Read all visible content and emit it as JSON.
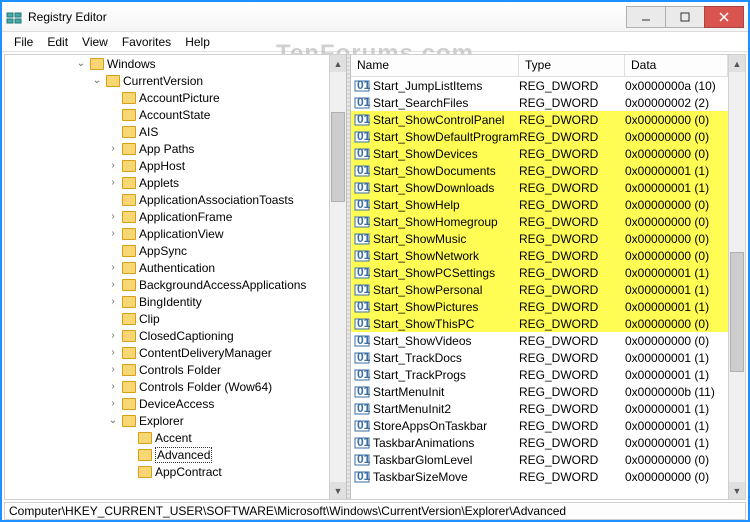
{
  "window": {
    "title": "Registry Editor"
  },
  "menu": [
    "File",
    "Edit",
    "View",
    "Favorites",
    "Help"
  ],
  "watermark": "TenForums.com",
  "tree": [
    {
      "d": 5,
      "e": "v",
      "l": "Windows"
    },
    {
      "d": 6,
      "e": "v",
      "l": "CurrentVersion"
    },
    {
      "d": 7,
      "e": "",
      "l": "AccountPicture"
    },
    {
      "d": 7,
      "e": "",
      "l": "AccountState"
    },
    {
      "d": 7,
      "e": "",
      "l": "AIS"
    },
    {
      "d": 7,
      "e": ">",
      "l": "App Paths"
    },
    {
      "d": 7,
      "e": ">",
      "l": "AppHost"
    },
    {
      "d": 7,
      "e": ">",
      "l": "Applets"
    },
    {
      "d": 7,
      "e": "",
      "l": "ApplicationAssociationToasts"
    },
    {
      "d": 7,
      "e": ">",
      "l": "ApplicationFrame"
    },
    {
      "d": 7,
      "e": ">",
      "l": "ApplicationView"
    },
    {
      "d": 7,
      "e": "",
      "l": "AppSync"
    },
    {
      "d": 7,
      "e": ">",
      "l": "Authentication"
    },
    {
      "d": 7,
      "e": ">",
      "l": "BackgroundAccessApplications"
    },
    {
      "d": 7,
      "e": ">",
      "l": "BingIdentity"
    },
    {
      "d": 7,
      "e": "",
      "l": "Clip"
    },
    {
      "d": 7,
      "e": ">",
      "l": "ClosedCaptioning"
    },
    {
      "d": 7,
      "e": ">",
      "l": "ContentDeliveryManager"
    },
    {
      "d": 7,
      "e": ">",
      "l": "Controls Folder"
    },
    {
      "d": 7,
      "e": ">",
      "l": "Controls Folder (Wow64)"
    },
    {
      "d": 7,
      "e": ">",
      "l": "DeviceAccess"
    },
    {
      "d": 7,
      "e": "v",
      "l": "Explorer"
    },
    {
      "d": 8,
      "e": "",
      "l": "Accent"
    },
    {
      "d": 8,
      "e": "",
      "l": "Advanced",
      "sel": true
    },
    {
      "d": 8,
      "e": "",
      "l": "AppContract"
    }
  ],
  "columns": {
    "name": "Name",
    "type": "Type",
    "data": "Data"
  },
  "values": [
    {
      "n": "Start_JumpListItems",
      "t": "REG_DWORD",
      "d": "0x0000000a (10)",
      "hl": false
    },
    {
      "n": "Start_SearchFiles",
      "t": "REG_DWORD",
      "d": "0x00000002 (2)",
      "hl": false
    },
    {
      "n": "Start_ShowControlPanel",
      "t": "REG_DWORD",
      "d": "0x00000000 (0)",
      "hl": true
    },
    {
      "n": "Start_ShowDefaultPrograms",
      "t": "REG_DWORD",
      "d": "0x00000000 (0)",
      "hl": true
    },
    {
      "n": "Start_ShowDevices",
      "t": "REG_DWORD",
      "d": "0x00000000 (0)",
      "hl": true
    },
    {
      "n": "Start_ShowDocuments",
      "t": "REG_DWORD",
      "d": "0x00000001 (1)",
      "hl": true
    },
    {
      "n": "Start_ShowDownloads",
      "t": "REG_DWORD",
      "d": "0x00000001 (1)",
      "hl": true
    },
    {
      "n": "Start_ShowHelp",
      "t": "REG_DWORD",
      "d": "0x00000000 (0)",
      "hl": true
    },
    {
      "n": "Start_ShowHomegroup",
      "t": "REG_DWORD",
      "d": "0x00000000 (0)",
      "hl": true
    },
    {
      "n": "Start_ShowMusic",
      "t": "REG_DWORD",
      "d": "0x00000000 (0)",
      "hl": true
    },
    {
      "n": "Start_ShowNetwork",
      "t": "REG_DWORD",
      "d": "0x00000000 (0)",
      "hl": true
    },
    {
      "n": "Start_ShowPCSettings",
      "t": "REG_DWORD",
      "d": "0x00000001 (1)",
      "hl": true
    },
    {
      "n": "Start_ShowPersonal",
      "t": "REG_DWORD",
      "d": "0x00000001 (1)",
      "hl": true
    },
    {
      "n": "Start_ShowPictures",
      "t": "REG_DWORD",
      "d": "0x00000001 (1)",
      "hl": true
    },
    {
      "n": "Start_ShowThisPC",
      "t": "REG_DWORD",
      "d": "0x00000000 (0)",
      "hl": true
    },
    {
      "n": "Start_ShowVideos",
      "t": "REG_DWORD",
      "d": "0x00000000 (0)",
      "hl": false
    },
    {
      "n": "Start_TrackDocs",
      "t": "REG_DWORD",
      "d": "0x00000001 (1)",
      "hl": false
    },
    {
      "n": "Start_TrackProgs",
      "t": "REG_DWORD",
      "d": "0x00000001 (1)",
      "hl": false
    },
    {
      "n": "StartMenuInit",
      "t": "REG_DWORD",
      "d": "0x0000000b (11)",
      "hl": false
    },
    {
      "n": "StartMenuInit2",
      "t": "REG_DWORD",
      "d": "0x00000001 (1)",
      "hl": false
    },
    {
      "n": "StoreAppsOnTaskbar",
      "t": "REG_DWORD",
      "d": "0x00000001 (1)",
      "hl": false
    },
    {
      "n": "TaskbarAnimations",
      "t": "REG_DWORD",
      "d": "0x00000001 (1)",
      "hl": false
    },
    {
      "n": "TaskbarGlomLevel",
      "t": "REG_DWORD",
      "d": "0x00000000 (0)",
      "hl": false
    },
    {
      "n": "TaskbarSizeMove",
      "t": "REG_DWORD",
      "d": "0x00000000 (0)",
      "hl": false
    }
  ],
  "statusbar": "Computer\\HKEY_CURRENT_USER\\SOFTWARE\\Microsoft\\Windows\\CurrentVersion\\Explorer\\Advanced"
}
